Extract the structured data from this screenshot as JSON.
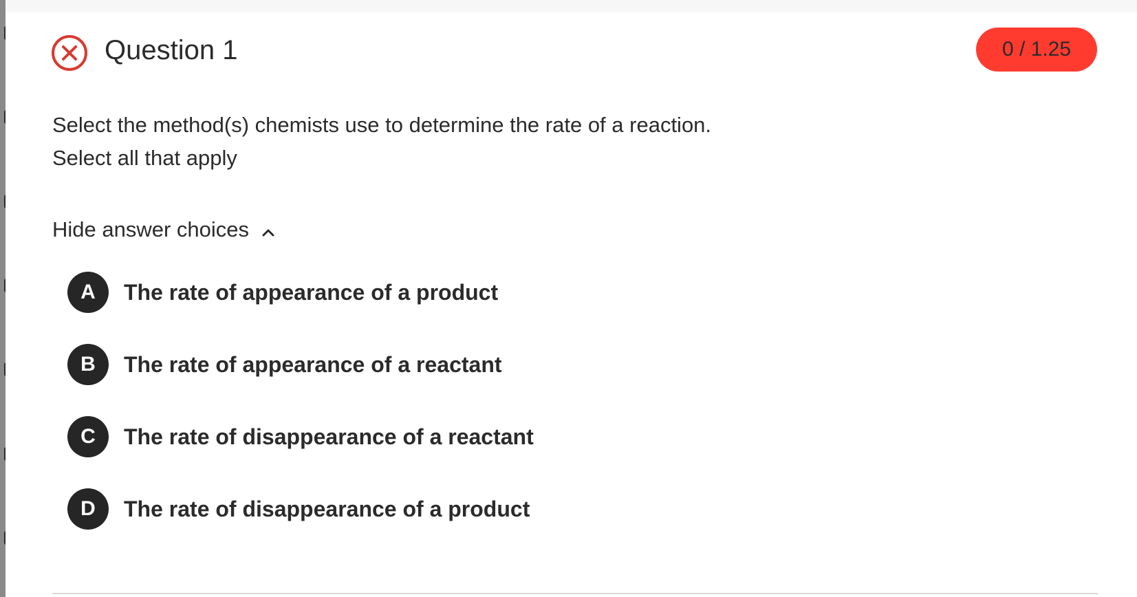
{
  "question": {
    "title": "Question 1",
    "status": "incorrect",
    "status_icon": "x-circle-icon",
    "score": "0 / 1.25",
    "prompt": "Select the method(s) chemists use to determine the rate of a reaction.",
    "instruction": "Select all that apply"
  },
  "answers": {
    "toggle_label": "Hide answer choices",
    "toggle_icon": "chevron-up-icon",
    "choices": [
      {
        "letter": "A",
        "text": "The rate of appearance of a product"
      },
      {
        "letter": "B",
        "text": "The rate of appearance of a reactant"
      },
      {
        "letter": "C",
        "text": "The rate of disappearance of a reactant"
      },
      {
        "letter": "D",
        "text": "The rate of disappearance of a product"
      }
    ]
  },
  "colors": {
    "incorrect": "#d93a2f",
    "score_badge": "#ff3b30",
    "choice_circle": "#262626",
    "text": "#2b2b2b"
  }
}
